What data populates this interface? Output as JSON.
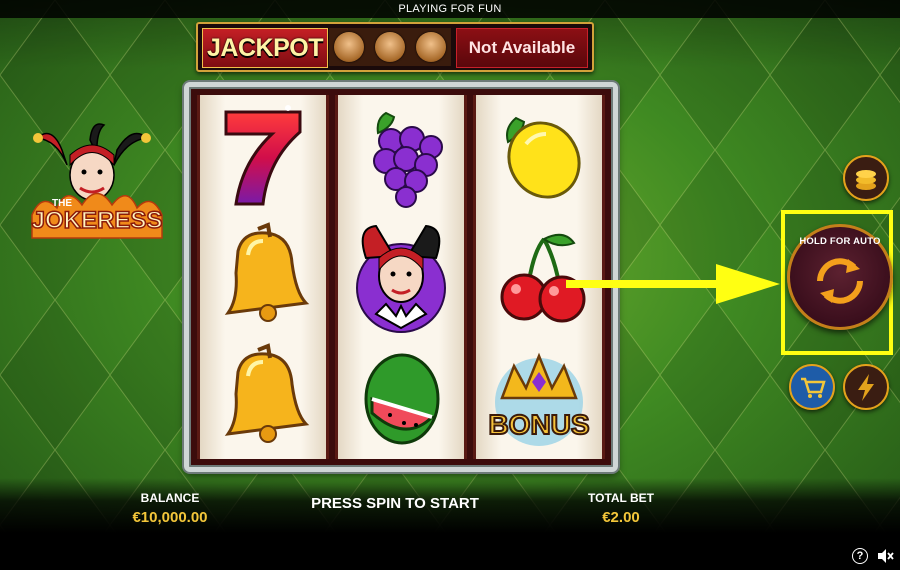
{
  "top_bar": {
    "title": "PLAYING FOR FUN"
  },
  "jackpot": {
    "label": "JACKPOT",
    "status": "Not Available"
  },
  "logo": {
    "line1": "THE",
    "line2": "JOKERESS"
  },
  "reels": [
    [
      "seven",
      "bell",
      "bell"
    ],
    [
      "grapes",
      "jokeress",
      "watermelon"
    ],
    [
      "lemon",
      "cherries",
      "bonus"
    ]
  ],
  "bonus_symbol_text": "BONUS",
  "controls": {
    "spin_label": "HOLD FOR AUTO",
    "coins_icon": "coins-icon",
    "cart_icon": "cart-icon",
    "turbo_icon": "lightning-icon"
  },
  "footer": {
    "balance_label": "BALANCE",
    "balance_value": "€10,000.00",
    "message": "PRESS SPIN TO START",
    "total_bet_label": "TOTAL BET",
    "total_bet_value": "€2.00"
  },
  "colors": {
    "highlight": "#ffff12",
    "accent": "#f3c63a",
    "jackpot_red": "#c41f25"
  }
}
